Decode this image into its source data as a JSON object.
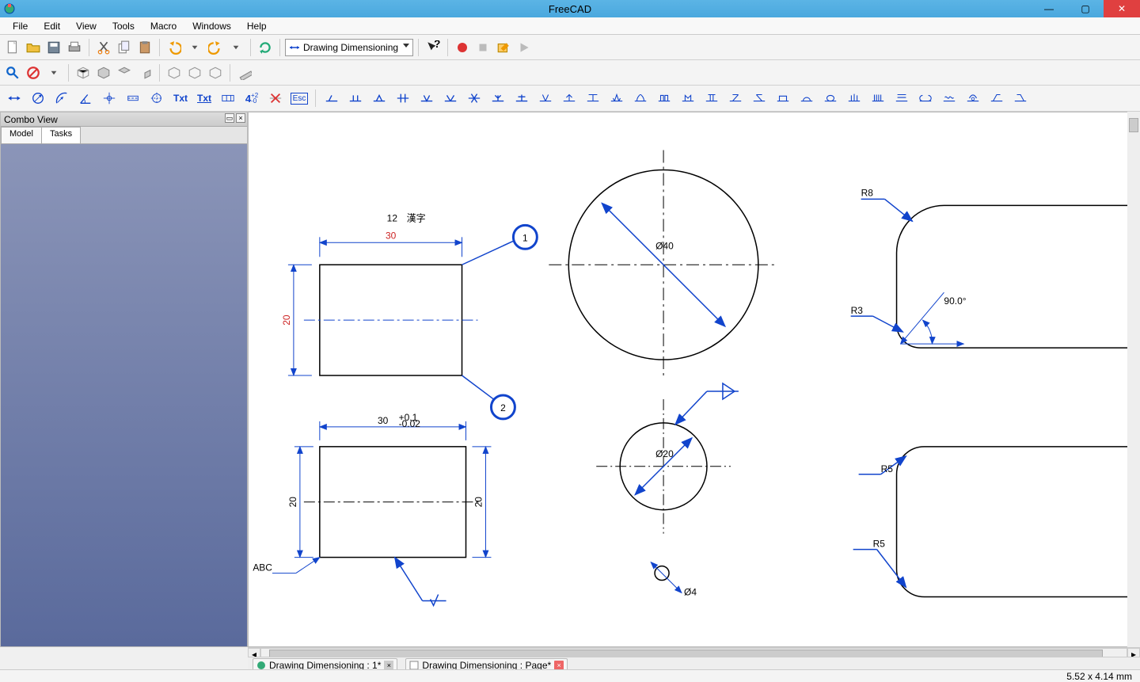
{
  "window": {
    "title": "FreeCAD",
    "min": "—",
    "max": "▢",
    "close": "✕"
  },
  "menus": [
    "File",
    "Edit",
    "View",
    "Tools",
    "Macro",
    "Windows",
    "Help"
  ],
  "workbench_selector": {
    "label": "Drawing Dimensioning"
  },
  "combo_view": {
    "title": "Combo View",
    "tabs": [
      "Model",
      "Tasks"
    ],
    "active_tab": 1
  },
  "doc_tabs": [
    {
      "label": "Drawing Dimensioning : 1*",
      "closable": "gray"
    },
    {
      "label": "Drawing Dimensioning : Page*",
      "closable": "red"
    }
  ],
  "status": {
    "coords": "5.52 x 4.14 mm"
  },
  "drawing": {
    "rect1": {
      "width_label": "30",
      "height_label": "20",
      "note12": "12",
      "note_kanji": "漢字",
      "balloon1": "1",
      "balloon2": "2"
    },
    "rect2": {
      "width_label": "30",
      "width_tol_upper": "+0.1",
      "width_tol_lower": "-0.02",
      "height_left": "20",
      "height_right": "20",
      "note_abc": "ABC"
    },
    "circle1": {
      "dia": "Ø40"
    },
    "circle2": {
      "dia": "Ø20"
    },
    "circle3": {
      "dia": "Ø4"
    },
    "fillets": {
      "r8": "R8",
      "r3": "R3",
      "angle": "90.0°",
      "r5a": "R5",
      "r5b": "R5"
    }
  },
  "dim_toolbar_labels": {
    "txt": "Txt",
    "txt2": "Txt",
    "four_plus": "4",
    "esc": "Esc"
  }
}
